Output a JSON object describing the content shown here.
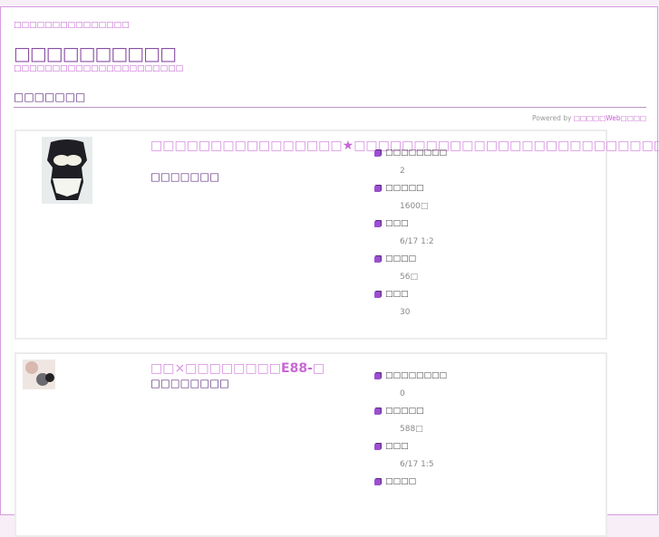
{
  "header": {
    "top_note": "□□□□□□□□□□□□□□□",
    "site_title": "□□□□□□□□□□",
    "site_desc": "□□□□□□□□□□□□□□□□□□□□□□",
    "section_heading": "□□□□□□□",
    "powered_prefix": "Powered by ",
    "powered_link": "□□□□□Web□□□□"
  },
  "items": [
    {
      "title_a": "□□□□□□□□□□□□□□□□",
      "title_star": "★",
      "title_b": "□□□□□□□□□□□□□□□□□□□□□□□□□□",
      "shop": "□□□□□□□",
      "fields": [
        {
          "label": "□□□□□□□□",
          "value": "2"
        },
        {
          "label": "□□□□□",
          "value": "1600□"
        },
        {
          "label": "□□□",
          "value": "6/17 1:2"
        },
        {
          "label": "□□□□",
          "value": "56□"
        },
        {
          "label": "□□□",
          "value": "30"
        }
      ]
    },
    {
      "title_a": "□□×□□□□□□□□",
      "title_star": "E88-",
      "title_b": "□",
      "shop": "□□□□□□□□",
      "fields": [
        {
          "label": "□□□□□□□□",
          "value": "0"
        },
        {
          "label": "□□□□□",
          "value": "588□"
        },
        {
          "label": "□□□",
          "value": "6/17 1:5"
        },
        {
          "label": "□□□□",
          "value": ""
        }
      ]
    }
  ]
}
